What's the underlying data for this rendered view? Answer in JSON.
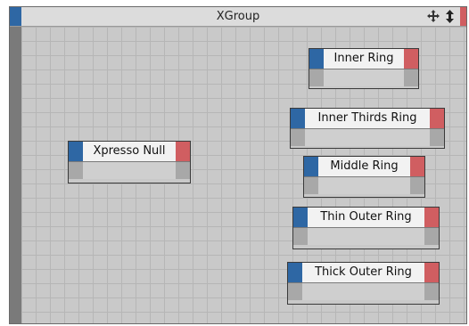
{
  "window": {
    "title": "XGroup",
    "icons": [
      "move-icon",
      "expand-icon"
    ],
    "colors": {
      "input_port": "#2e67a4",
      "output_port": "#d05e61",
      "canvas": "#c9c9c9",
      "node_header": "#f2f2f2"
    }
  },
  "nodes": [
    {
      "label": "Inner Ring"
    },
    {
      "label": "Inner Thirds Ring"
    },
    {
      "label": "Xpresso Null"
    },
    {
      "label": "Middle Ring"
    },
    {
      "label": "Thin Outer Ring"
    },
    {
      "label": "Thick Outer Ring"
    }
  ]
}
